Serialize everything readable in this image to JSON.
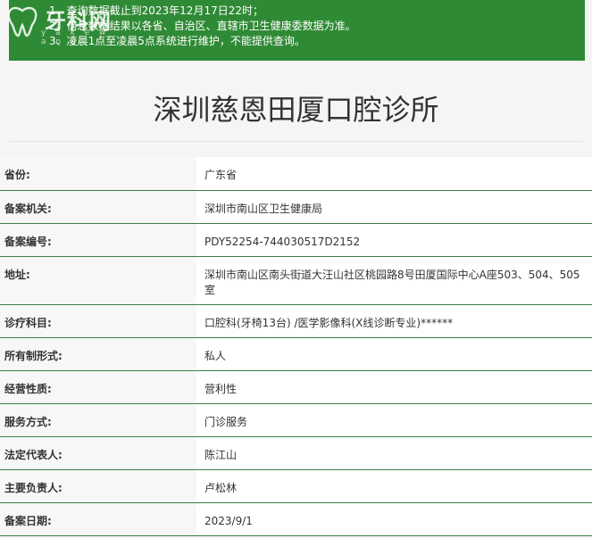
{
  "notice": {
    "lines": [
      "1、查询数据截止到2023年12月17日22时；",
      "2、信息数据结果以各省、自治区、直辖市卫生健康委数据为准。",
      "3、凌晨1点至凌晨5点系统进行维护，不能提供查询。"
    ]
  },
  "logo": {
    "text": "牙科网",
    "sub": "y a k e w a n g"
  },
  "page_title": "深圳慈恩田厦口腔诊所",
  "rows": [
    {
      "label": "省份:",
      "value": "广东省"
    },
    {
      "label": "备案机关:",
      "value": "深圳市南山区卫生健康局"
    },
    {
      "label": "备案编号:",
      "value": "PDY52254-744030517D2152"
    },
    {
      "label": "地址:",
      "value": "深圳市南山区南头街道大汪山社区桃园路8号田厦国际中心A座503、504、505室"
    },
    {
      "label": "诊疗科目:",
      "value": "口腔科(牙椅13台) /医学影像科(X线诊断专业)******"
    },
    {
      "label": "所有制形式:",
      "value": "私人"
    },
    {
      "label": "经营性质:",
      "value": "营利性"
    },
    {
      "label": "服务方式:",
      "value": "门诊服务"
    },
    {
      "label": "法定代表人:",
      "value": "陈江山"
    },
    {
      "label": "主要负责人:",
      "value": "卢松林"
    },
    {
      "label": "备案日期:",
      "value": "2023/9/1"
    }
  ],
  "colors": {
    "notice_bg": "#2f8a35",
    "row_border": "#3d7f45"
  }
}
